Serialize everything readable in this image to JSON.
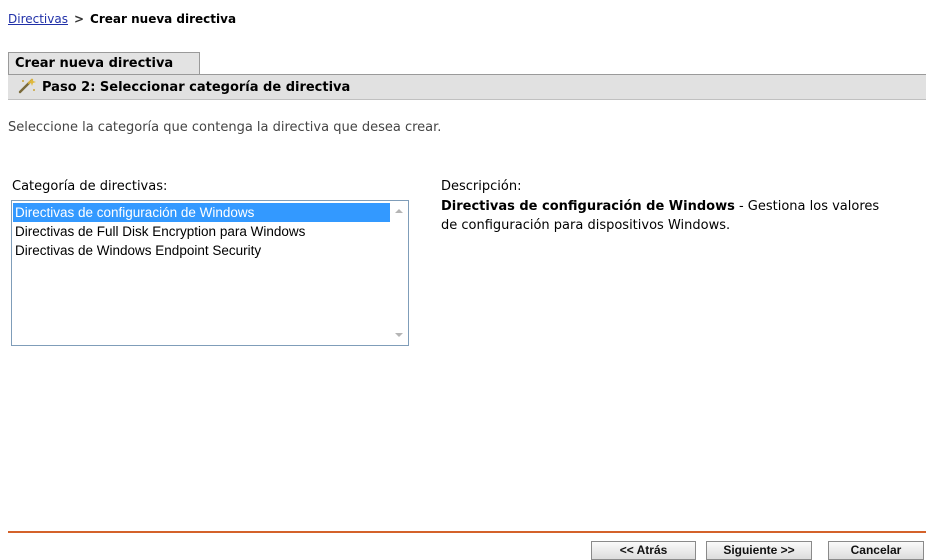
{
  "breadcrumb": {
    "link": "Directivas",
    "separator": ">",
    "current": "Crear nueva directiva"
  },
  "tab": {
    "label": "Crear nueva directiva"
  },
  "step": {
    "title": "Paso 2: Seleccionar categoría de directiva",
    "icon": "wand-icon"
  },
  "intro": "Seleccione la categoría que contenga la directiva que desea crear.",
  "category": {
    "label": "Categoría de directivas:",
    "items": [
      "Directivas de configuración de Windows",
      "Directivas de Full Disk Encryption para Windows",
      "Directivas de Windows Endpoint Security"
    ],
    "selected_index": 0
  },
  "description": {
    "label": "Descripción:",
    "title": "Directivas de configuración de Windows",
    "text": " - Gestiona los valores de configuración para dispositivos Windows."
  },
  "buttons": {
    "back": "<< Atrás",
    "next": "Siguiente >>",
    "cancel": "Cancelar"
  },
  "colors": {
    "accent_line": "#d4622a",
    "selection": "#3399ff",
    "link": "#2030a8"
  }
}
